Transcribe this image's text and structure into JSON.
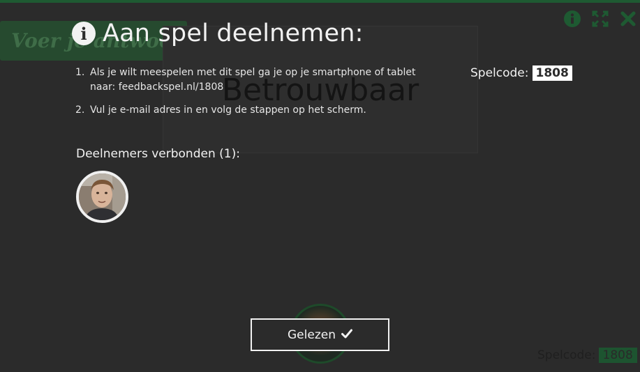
{
  "background": {
    "banner_text": "Voer je antwoord in",
    "card_word": "Betrouwbaar",
    "spelcode_label": "Spelcode:",
    "spelcode_value": "1808",
    "icons": [
      "info-icon",
      "expand-icon",
      "close-icon"
    ]
  },
  "modal": {
    "title": "Aan spel deelnemen:",
    "title_icon": "info-icon",
    "instructions": [
      {
        "num": "1.",
        "text": "Als je wilt meespelen met dit spel ga je op je smartphone of tablet naar: feedbackspel.nl/1808"
      },
      {
        "num": "2.",
        "text": "Vul je e-mail adres in en volg de stappen op het scherm."
      }
    ],
    "spelcode_label": "Spelcode:",
    "spelcode_value": "1808",
    "connected_label": "Deelnemers verbonden (1):",
    "button_label": "Gelezen",
    "button_icon": "checkmark-icon"
  },
  "colors": {
    "overlay": "#2b2b2b",
    "brand_green": "#1e5a32",
    "text": "#e6e6e6"
  }
}
